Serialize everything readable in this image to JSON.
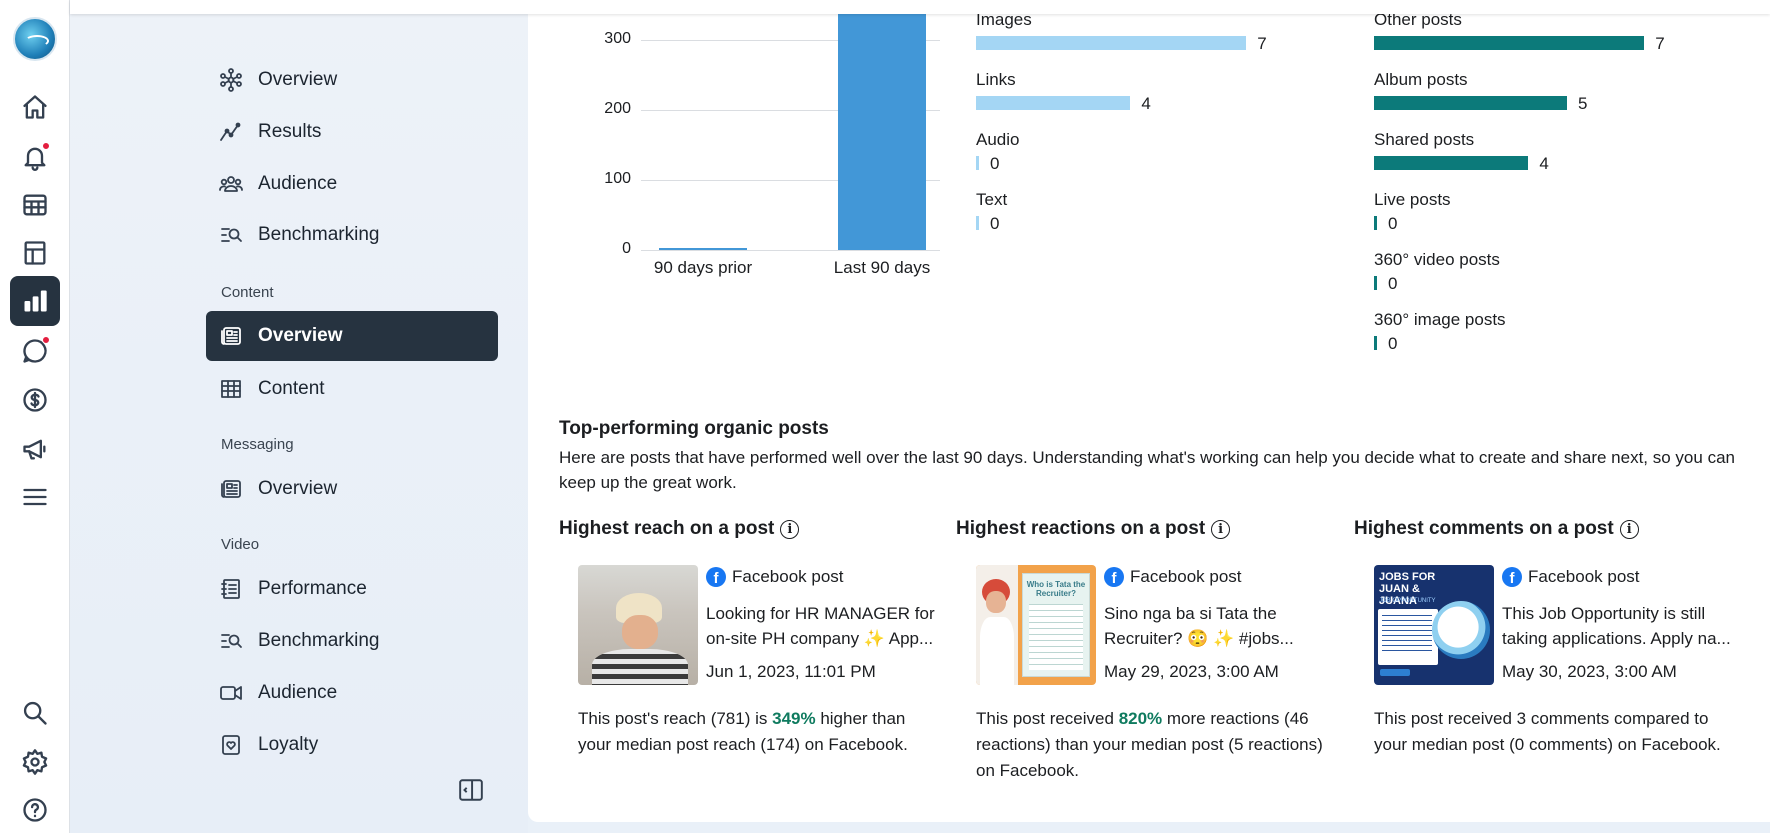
{
  "rail": {
    "items": [
      {
        "name": "home"
      },
      {
        "name": "notifications"
      },
      {
        "name": "planner"
      },
      {
        "name": "content"
      },
      {
        "name": "insights"
      },
      {
        "name": "inbox"
      },
      {
        "name": "monetization"
      },
      {
        "name": "ads"
      },
      {
        "name": "all-tools"
      },
      {
        "name": "search"
      },
      {
        "name": "settings"
      },
      {
        "name": "help"
      }
    ]
  },
  "nav": {
    "top": [
      {
        "label": "Overview"
      },
      {
        "label": "Results"
      },
      {
        "label": "Audience"
      },
      {
        "label": "Benchmarking"
      }
    ],
    "content_label": "Content",
    "content": [
      {
        "label": "Overview"
      },
      {
        "label": "Content"
      }
    ],
    "messaging_label": "Messaging",
    "messaging": [
      {
        "label": "Overview"
      }
    ],
    "video_label": "Video",
    "video": [
      {
        "label": "Performance"
      },
      {
        "label": "Benchmarking"
      },
      {
        "label": "Audience"
      },
      {
        "label": "Loyalty"
      }
    ]
  },
  "chart_data": {
    "type": "bar",
    "categories": [
      "90 days prior",
      "Last 90 days"
    ],
    "values": [
      2,
      360
    ],
    "yticks": [
      "0",
      "100",
      "200",
      "300"
    ],
    "ylim": [
      0,
      350
    ],
    "title": "",
    "xlabel": "",
    "ylabel": ""
  },
  "format_breakdown": [
    {
      "label": "Images",
      "value": "7",
      "n": 7
    },
    {
      "label": "Links",
      "value": "4",
      "n": 4
    },
    {
      "label": "Audio",
      "value": "0",
      "n": 0
    },
    {
      "label": "Text",
      "value": "0",
      "n": 0
    }
  ],
  "type_breakdown": [
    {
      "label": "Other posts",
      "value": "7",
      "n": 7
    },
    {
      "label": "Album posts",
      "value": "5",
      "n": 5
    },
    {
      "label": "Shared posts",
      "value": "4",
      "n": 4
    },
    {
      "label": "Live posts",
      "value": "0",
      "n": 0
    },
    {
      "label": "360° video posts",
      "value": "0",
      "n": 0
    },
    {
      "label": "360° image posts",
      "value": "0",
      "n": 0
    }
  ],
  "colors": {
    "bar": "#4297d7",
    "format": "#a4d6f4",
    "type": "#0c7a7a",
    "accent": "#0f7b5f",
    "active_nav": "#263340"
  },
  "top_posts": {
    "title": "Top-performing organic posts",
    "description": "Here are posts that have performed well over the last 90 days. Understanding what's working can help you decide what to create and share next, so you can keep up the great work.",
    "columns": [
      {
        "title": "Highest reach on a post",
        "post_type": "Facebook post",
        "text": "Looking for HR MANAGER for on-site PH company ✨ App...",
        "date": "Jun 1, 2023, 11:01 PM",
        "summary_pre": "This post's reach (781) is ",
        "summary_pct": "349%",
        "summary_post": " higher than your median post reach (174) on Facebook."
      },
      {
        "title": "Highest reactions on a post",
        "post_type": "Facebook post",
        "text": "Sino nga ba si Tata the Recruiter? 😳 ✨ #jobs...",
        "date": "May 29, 2023, 3:00 AM",
        "summary_pre": "This post received ",
        "summary_pct": "820%",
        "summary_post": " more reactions (46 reactions) than your median post (5 reactions) on Facebook.",
        "thumb_title": "Who is Tata the Recruiter?"
      },
      {
        "title": "Highest comments on a post",
        "post_type": "Facebook post",
        "text": "This Job Opportunity is still taking applications. Apply na...",
        "date": "May 30, 2023, 3:00 AM",
        "summary_pre": "This post received 3 comments compared to your median post (0 comments) on Facebook.",
        "summary_pct": "",
        "summary_post": "",
        "thumb_title": "JOBS FOR JUAN & JUANA",
        "thumb_sub": "JOB OPPORTUNITY"
      }
    ]
  },
  "info_symbol": "i",
  "fb_letter": "f"
}
